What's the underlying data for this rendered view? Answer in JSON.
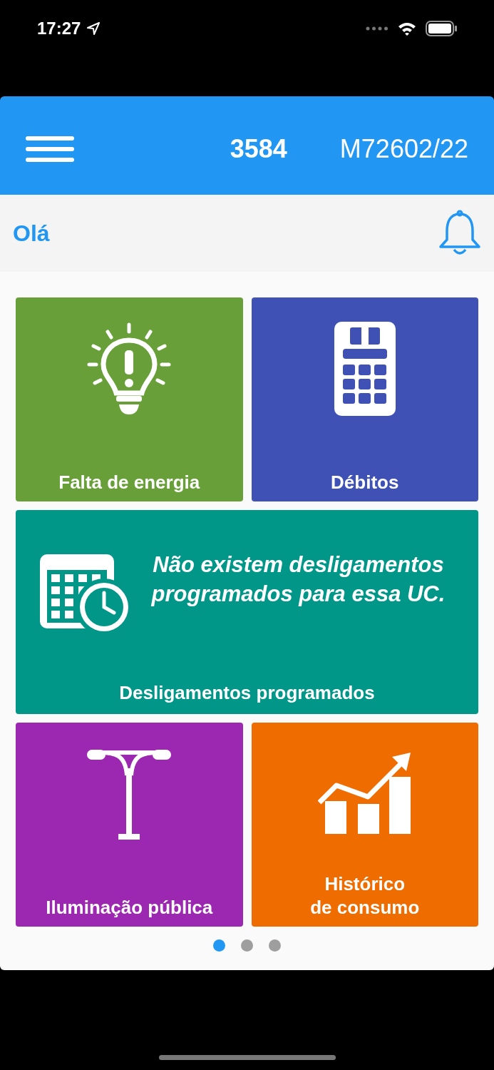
{
  "status_bar": {
    "time": "17:27"
  },
  "header": {
    "account": "3584",
    "meter": "M72602/22"
  },
  "greeting": "Olá",
  "tiles": [
    {
      "kind": "outage",
      "label": "Falta de energia",
      "color": "#689f38"
    },
    {
      "kind": "debts",
      "label": "Débitos",
      "color": "#3f51b5"
    },
    {
      "kind": "schedule",
      "label": "Desligamentos programados",
      "message": "Não existem desligamentos programados para essa UC.",
      "color": "#009688"
    },
    {
      "kind": "lighting",
      "label": "Iluminação pública",
      "color": "#9c27b0"
    },
    {
      "kind": "history",
      "label": "Histórico\nde consumo",
      "color": "#ef6c00"
    }
  ],
  "pager": [
    {
      "selected": true
    },
    {
      "selected": false
    },
    {
      "selected": false
    }
  ]
}
